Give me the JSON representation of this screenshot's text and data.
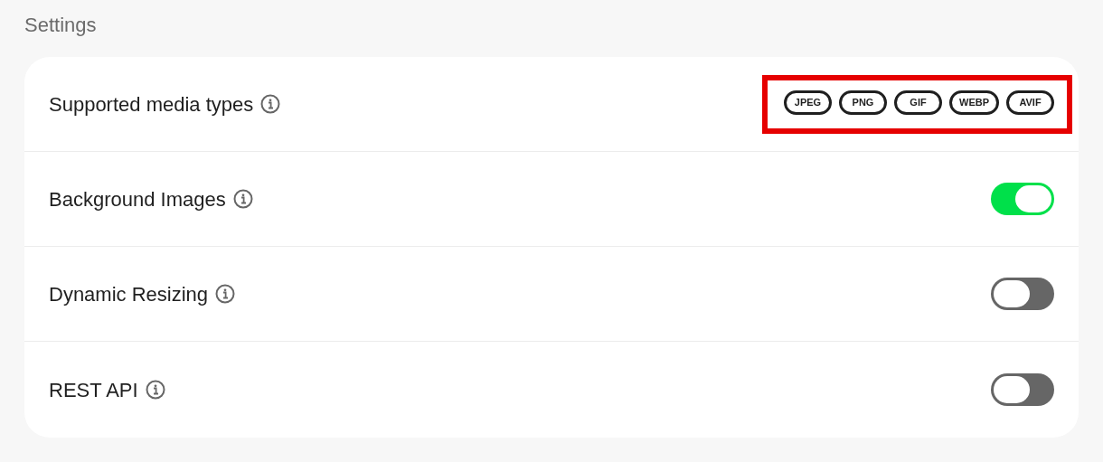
{
  "title": "Settings",
  "settings": [
    {
      "kind": "chips",
      "label": "Supported media types",
      "highlighted": true,
      "chips": [
        "JPEG",
        "PNG",
        "GIF",
        "WEBP",
        "AVIF"
      ]
    },
    {
      "kind": "toggle",
      "label": "Background Images",
      "on": true
    },
    {
      "kind": "toggle",
      "label": "Dynamic Resizing",
      "on": false
    },
    {
      "kind": "toggle",
      "label": "REST API",
      "on": false
    }
  ]
}
